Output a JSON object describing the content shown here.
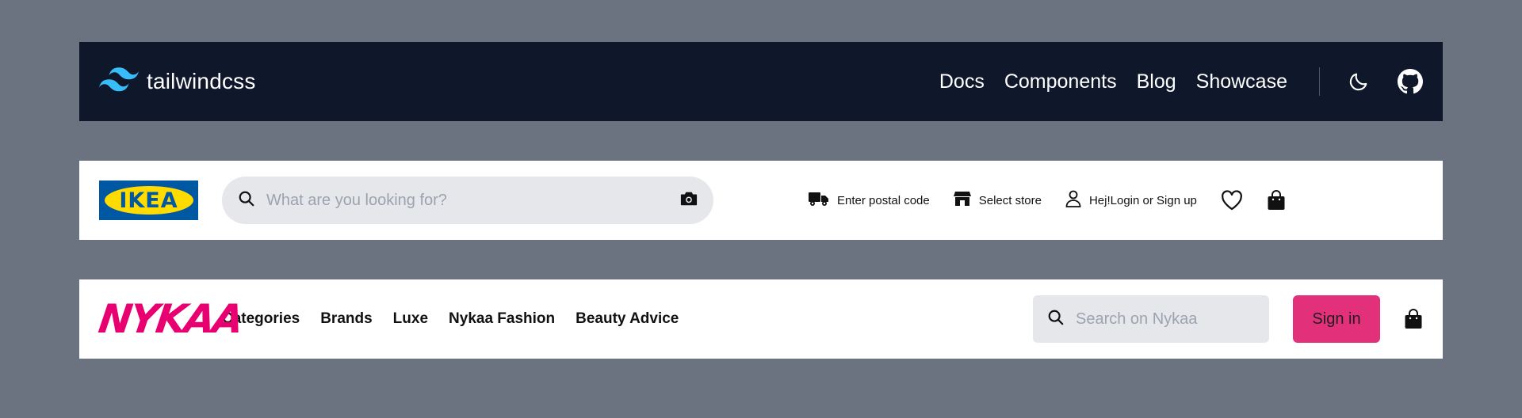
{
  "tailwind": {
    "brand": "tailwindcss",
    "nav": [
      "Docs",
      "Components",
      "Blog",
      "Showcase"
    ],
    "icons": {
      "theme": "moon-icon",
      "repo": "github-icon",
      "logo": "tailwind-wave-icon"
    },
    "colors": {
      "background": "#0f172a",
      "logo": "#38bdf8",
      "text": "#ffffff"
    }
  },
  "ikea": {
    "logo_text": "IKEA",
    "search_placeholder": "What are you looking for?",
    "actions": {
      "postal": "Enter postal code",
      "store": "Select store",
      "login": "Hej!Login or Sign up"
    },
    "icons": [
      "search-icon",
      "camera-icon",
      "truck-icon",
      "store-icon",
      "user-icon",
      "heart-icon",
      "shopping-bag-icon"
    ],
    "colors": {
      "logo_blue": "#0058a3",
      "logo_yellow": "#ffdb00",
      "search_bg": "#e5e7eb"
    }
  },
  "nykaa": {
    "logo_text": "NYKAA",
    "nav": [
      "Categories",
      "Brands",
      "Luxe",
      "Nykaa Fashion",
      "Beauty Advice"
    ],
    "search_placeholder": "Search on Nykaa",
    "signin_label": "Sign in",
    "icons": [
      "search-icon",
      "shopping-bag-icon"
    ],
    "colors": {
      "brand": "#e80071",
      "button": "#e2307a"
    }
  }
}
